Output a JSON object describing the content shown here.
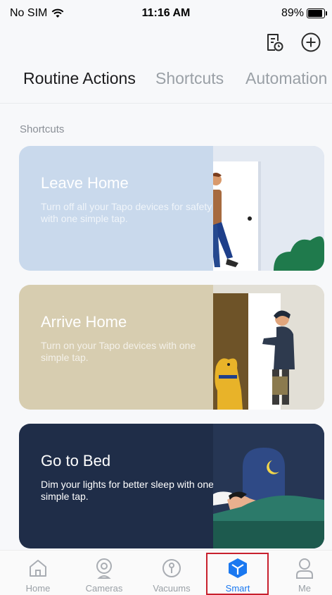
{
  "status": {
    "carrier": "No SIM",
    "time": "11:16 AM",
    "battery": "89%",
    "battery_level": 0.89
  },
  "top_actions": {
    "log_icon": "log-clock-icon",
    "add_icon": "add-circle-icon"
  },
  "tabs": [
    {
      "label": "Routine Actions",
      "active": true
    },
    {
      "label": "Shortcuts",
      "active": false
    },
    {
      "label": "Automation",
      "active": false
    }
  ],
  "section": {
    "title": "Shortcuts"
  },
  "cards": [
    {
      "title": "Leave Home",
      "desc": "Turn off all your Tapo devices for safety with one simple tap.",
      "color": "#c9d9ec"
    },
    {
      "title": "Arrive Home",
      "desc": "Turn on your Tapo devices with one simple tap.",
      "color": "#d7cdb0"
    },
    {
      "title": "Go to Bed",
      "desc": "Dim your lights for better sleep with one simple tap.",
      "color": "#1f2d48"
    }
  ],
  "nav": [
    {
      "label": "Home",
      "icon": "home-icon",
      "active": false
    },
    {
      "label": "Cameras",
      "icon": "camera-icon",
      "active": false
    },
    {
      "label": "Vacuums",
      "icon": "vacuum-icon",
      "active": false
    },
    {
      "label": "Smart",
      "icon": "smart-cube-icon",
      "active": true
    },
    {
      "label": "Me",
      "icon": "person-icon",
      "active": false
    }
  ],
  "colors": {
    "accent": "#1a78f0",
    "highlight": "#c8202d"
  }
}
